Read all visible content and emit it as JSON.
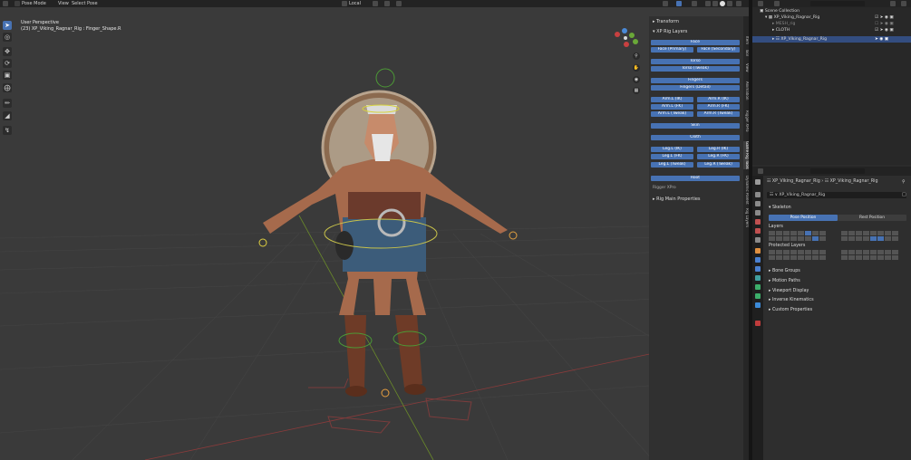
{
  "header": {
    "mode": "Pose Mode",
    "menus": [
      "View",
      "Select",
      "Pose"
    ],
    "transform_orientation": "Local",
    "pose_options": "Pose Options"
  },
  "viewport": {
    "perspective": "User Perspective",
    "active_object": "(23) XP_Viking_Ragnar_Rig : Finger_Shape.R"
  },
  "npanel": {
    "transform": "Transform",
    "rig_layers": "XP Rig Layers",
    "buttons": {
      "face": "Face",
      "face_primary": "Face (Primary)",
      "face_secondary": "Face (Secondary)",
      "torso": "Torso",
      "torso_tweak": "Torso (Tweak)",
      "fingers": "Fingers",
      "fingers_detail": "Fingers (Detail)",
      "arm_l_ik": "Arm.L (IK)",
      "arm_r_ik": "Arm.R (IK)",
      "arm_l_fk": "Arm.L (FK)",
      "arm_r_fk": "Arm.R (FK)",
      "arm_l_tweak": "Arm.L (Tweak)",
      "arm_r_tweak": "Arm.R (Tweak)",
      "skin": "Skin",
      "cloth": "Cloth",
      "leg_l_ik": "Leg.L (IK)",
      "leg_r_ik": "Leg.R (IK)",
      "leg_l_fk": "Leg.L (FK)",
      "leg_r_fk": "Leg.R (FK)",
      "leg_l_tweak": "Leg.L (Tweak)",
      "leg_r_tweak": "Leg.R (Tweak)",
      "root": "Root"
    },
    "rigger_xpro": "Rigger XPro",
    "rig_main_properties": "Rig Main Properties",
    "tabs": [
      "Item",
      "Tool",
      "View",
      "Animation",
      "Rigger XPro",
      "Game Rig Tools",
      "Dynamic Parent",
      "Rig Layers"
    ]
  },
  "outliner": {
    "scene_collection": "Scene Collection",
    "rows": [
      {
        "name": "XP_Viking_Ragnar_Rig",
        "level": 1
      },
      {
        "name": "MESH_rig",
        "level": 2
      },
      {
        "name": "CLOTH",
        "level": 2
      },
      {
        "name": "XP_Viking_Ragnar_Rig",
        "level": 2
      }
    ]
  },
  "properties": {
    "breadcrumb_a": "XP_Viking_Ragnar_Rig",
    "breadcrumb_b": "XP_Viking_Ragnar_Rig",
    "data_name": "XP_Viking_Ragnar_Rig",
    "skeleton": "Skeleton",
    "pose_position": "Pose Position",
    "rest_position": "Rest Position",
    "layers": "Layers",
    "protected_layers": "Protected Layers",
    "panels": [
      "Bone Groups",
      "Motion Paths",
      "Viewport Display",
      "Inverse Kinematics",
      "Custom Properties"
    ]
  },
  "colors": {
    "accent_blue": "#4772b3",
    "viewport_bg": "#3a3a3a",
    "panel_bg": "#303030"
  }
}
